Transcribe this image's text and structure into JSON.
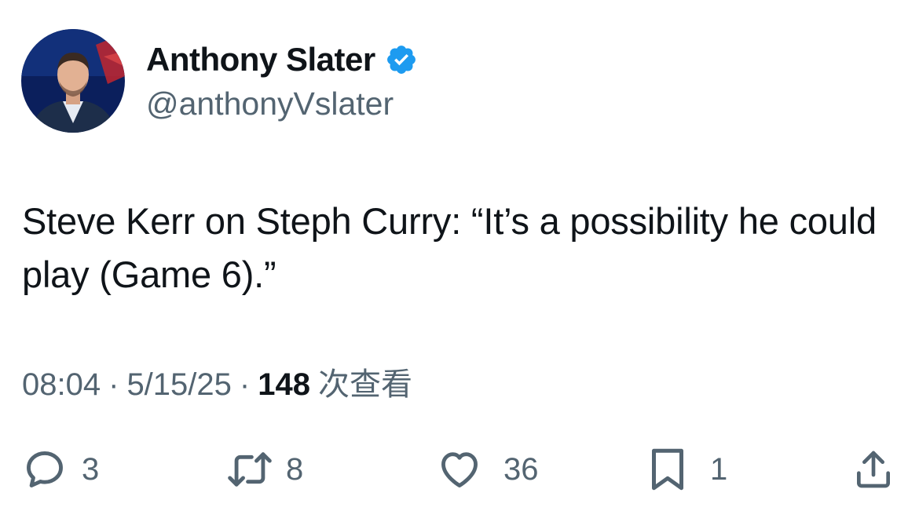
{
  "author": {
    "name": "Anthony Slater",
    "handle": "@anthonyVslater"
  },
  "tweet": {
    "text": "Steve Kerr on Steph Curry: “It’s a possibility he could play (Game 6).”",
    "time": "08:04",
    "separator": "·",
    "date": "5/15/25",
    "views_count": "148",
    "views_label": "次查看"
  },
  "actions": {
    "replies": "3",
    "reposts": "8",
    "likes": "36",
    "bookmarks": "1"
  },
  "colors": {
    "verified": "#1d9bf0",
    "secondary_text": "#536471",
    "primary_text": "#0f1419"
  }
}
